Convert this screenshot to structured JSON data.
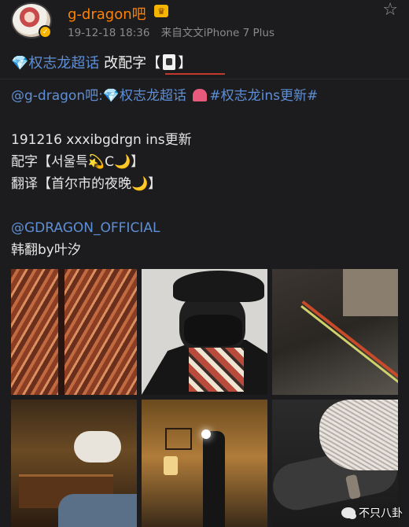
{
  "post": {
    "username": "g-dragon吧",
    "timestamp": "19-12-18 18:36",
    "source": "来自文文iPhone 7 Plus",
    "topic_tag": "💎权志龙超话",
    "title_text": " 改配字【",
    "title_end": "】"
  },
  "body": {
    "mention": "@g-dragon吧:",
    "topic1": "💎权志龙超话",
    "topic2": "#权志龙ins更新#",
    "line_update": "191216 xxxibgdrgn ins更新",
    "line_caption": "配字【서울특💫C🌙】",
    "line_translation": "翻译【首尔市的夜晚🌙】",
    "mention_gd": "@GDRAGON_OFFICIAL",
    "translator": "韩翻by叶汐"
  },
  "watermark": {
    "text": "不只八卦"
  },
  "icons": {
    "star": "star-icon",
    "verified": "verified-icon",
    "crown": "crown-icon",
    "card": "playing-card-icon",
    "heart": "heart-icon"
  },
  "colors": {
    "accent_orange": "#ff8200",
    "link_blue": "#5e8fd6",
    "background": "#1c1c1e"
  }
}
